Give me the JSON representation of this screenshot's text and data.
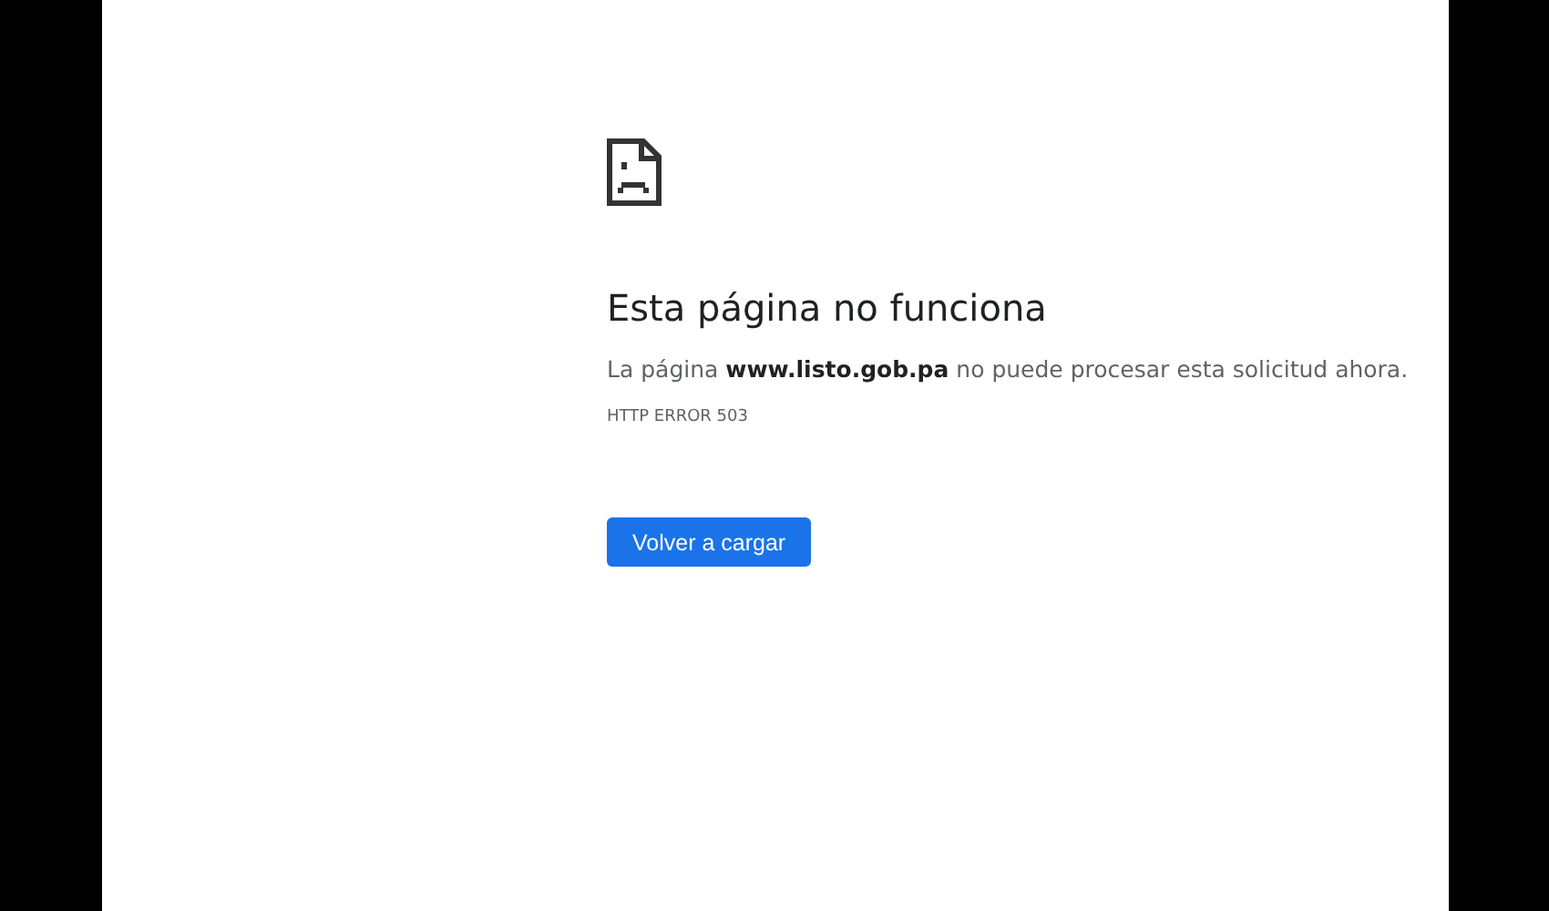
{
  "error_page": {
    "heading": "Esta página no funciona",
    "message": "La página **www.listo.gob.pa** no puede procesar esta solicitud ahora.",
    "error_code": "HTTP ERROR 503",
    "button": "Volver a cargar"
  }
}
